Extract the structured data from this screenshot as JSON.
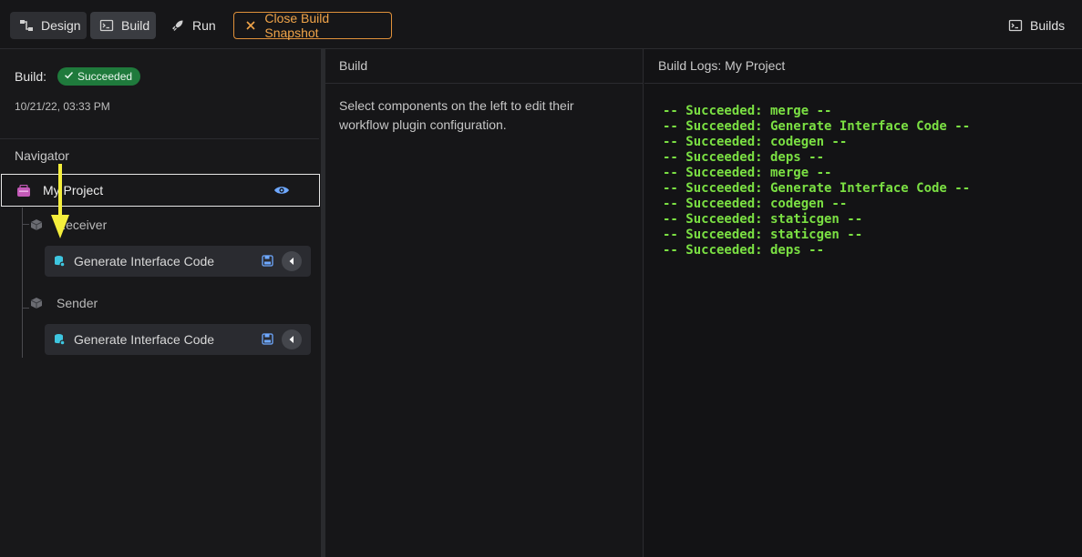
{
  "toolbar": {
    "design_label": "Design",
    "build_label": "Build",
    "run_label": "Run",
    "close_snapshot_label": "Close Build Snapshot",
    "builds_label": "Builds",
    "accent_color": "#f0a449"
  },
  "build_info": {
    "label": "Build:",
    "status": "Succeeded",
    "status_color": "#1f7a3c",
    "timestamp": "10/21/22, 03:33 PM"
  },
  "navigator": {
    "title": "Navigator",
    "root": {
      "label": "My Project"
    },
    "children": [
      {
        "label": "Receiver",
        "component": "Generate Interface Code"
      },
      {
        "label": "Sender",
        "component": "Generate Interface Code"
      }
    ]
  },
  "build_panel": {
    "header": "Build",
    "hint": "Select components on the left to edit their workflow plugin configuration."
  },
  "logs_panel": {
    "header": "Build Logs: My Project",
    "lines": [
      "-- Succeeded: merge --",
      "-- Succeeded: Generate Interface Code --",
      "-- Succeeded: codegen --",
      "-- Succeeded: deps --",
      "-- Succeeded: merge --",
      "-- Succeeded: Generate Interface Code --",
      "-- Succeeded: codegen --",
      "-- Succeeded: staticgen --",
      "-- Succeeded: staticgen --",
      "-- Succeeded: deps --"
    ],
    "text_color": "#7be043"
  }
}
